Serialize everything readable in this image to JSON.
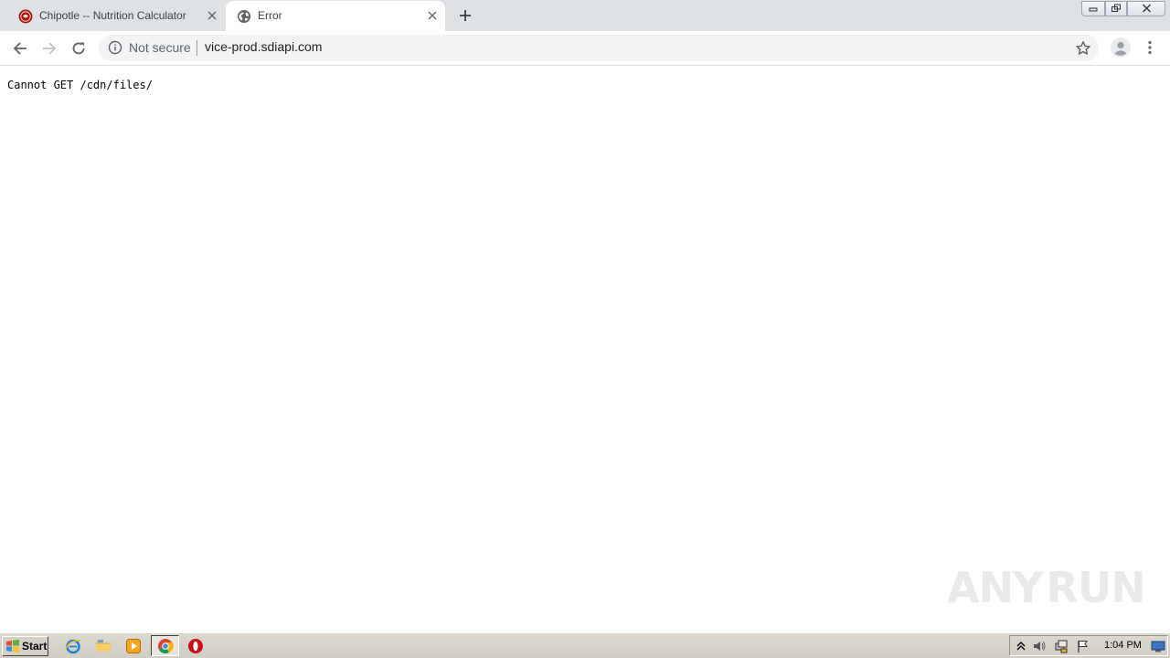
{
  "tabs": [
    {
      "title": "Chipotle -- Nutrition Calculator",
      "active": false,
      "favicon": "chipotle-logo-icon"
    },
    {
      "title": "Error",
      "active": true,
      "favicon": "globe-icon"
    }
  ],
  "toolbar": {
    "security_label": "Not secure",
    "url": "vice-prod.sdiapi.com"
  },
  "page": {
    "error_text": "Cannot GET /cdn/files/"
  },
  "watermark": {
    "text_left": "ANY",
    "text_right": "RUN"
  },
  "taskbar": {
    "start_label": "Start",
    "clock": "1:04 PM"
  },
  "colors": {
    "tabstrip_bg": "#dee1e6",
    "omnibox_bg": "#f1f3f4",
    "chipotle_red": "#a81612"
  }
}
